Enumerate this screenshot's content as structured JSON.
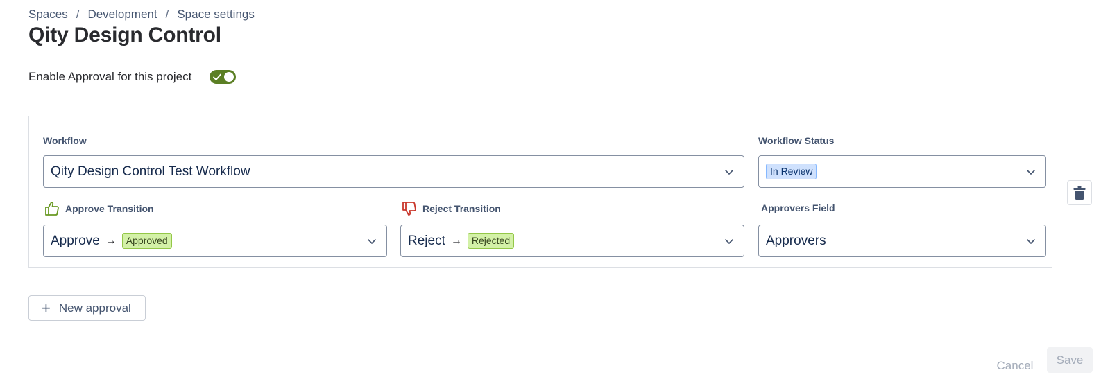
{
  "breadcrumb": {
    "items": [
      "Spaces",
      "Development",
      "Space settings"
    ],
    "separator": "/"
  },
  "page": {
    "title": "Qity Design Control"
  },
  "approval_toggle": {
    "label": "Enable Approval for this project",
    "enabled": true,
    "color": "#5b7f24"
  },
  "approval_card": {
    "workflow": {
      "label": "Workflow",
      "value": "Qity Design Control Test Workflow"
    },
    "workflow_status": {
      "label": "Workflow Status",
      "value": "In Review"
    },
    "approve_transition": {
      "label": "Approve Transition",
      "action": "Approve",
      "arrow": "→",
      "status": "Approved",
      "icon": "thumbs-up-icon",
      "icon_color": "#6a9a23"
    },
    "reject_transition": {
      "label": "Reject Transition",
      "action": "Reject",
      "arrow": "→",
      "status": "Rejected",
      "icon": "thumbs-down-icon",
      "icon_color": "#c9372c"
    },
    "approvers_field": {
      "label": "Approvers Field",
      "value": "Approvers"
    },
    "delete_icon": "trash-icon"
  },
  "actions": {
    "new_approval": "New approval",
    "cancel": "Cancel",
    "save": "Save"
  }
}
